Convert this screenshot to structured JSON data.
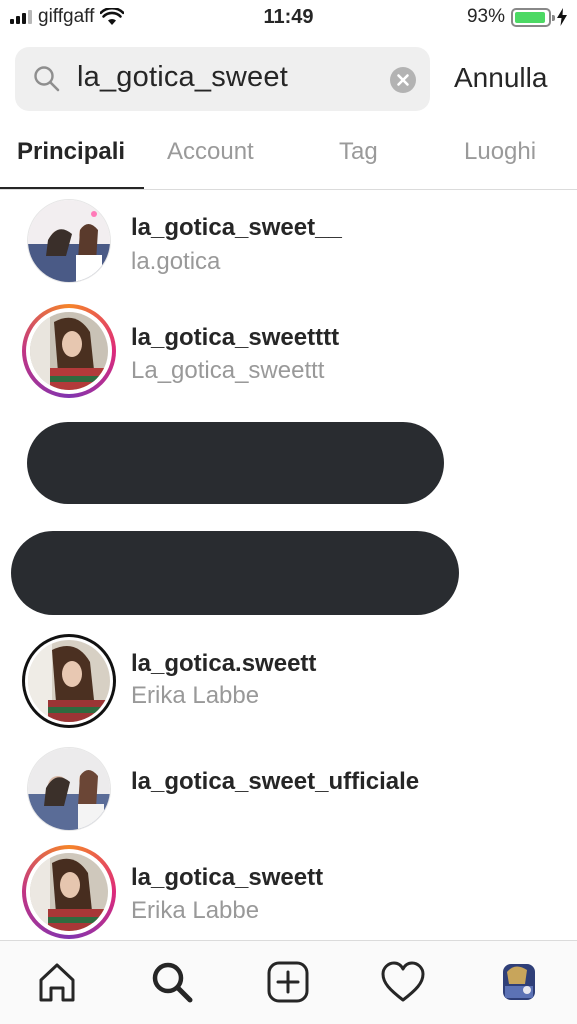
{
  "status_bar": {
    "carrier": "giffgaff",
    "time": "11:49",
    "battery_percent": "93%",
    "battery_level": 0.93,
    "battery_color": "#4cd964"
  },
  "search": {
    "query": "la_gotica_sweet",
    "cancel_label": "Annulla"
  },
  "tabs": [
    {
      "label": "Principali",
      "active": true
    },
    {
      "label": "Account",
      "active": false
    },
    {
      "label": "Tag",
      "active": false
    },
    {
      "label": "Luoghi",
      "active": false
    }
  ],
  "results": [
    {
      "username": "la_gotica_sweet__",
      "full_name": "la.gotica",
      "story_ring": false
    },
    {
      "username": "la_gotica_sweetttt",
      "full_name": "La_gotica_sweettt",
      "story_ring": true
    },
    {
      "redacted": true
    },
    {
      "redacted": true
    },
    {
      "username": "la_gotica.sweett",
      "full_name": "Erika Labbe",
      "story_ring": false
    },
    {
      "username": "la_gotica_sweet_ufficiale",
      "full_name": "",
      "story_ring": false
    },
    {
      "username": "la_gotica_sweett",
      "full_name": "Erika Labbe",
      "story_ring": true
    }
  ],
  "bottom_nav": {
    "items": [
      "home-icon",
      "search-icon",
      "add-post-icon",
      "activity-heart-icon",
      "profile-avatar"
    ],
    "active": "search-icon"
  },
  "colors": {
    "story_ring": [
      "#f58529",
      "#dd2a7b",
      "#8134af"
    ],
    "redaction": "#292c30",
    "secondary_text": "#999999"
  }
}
